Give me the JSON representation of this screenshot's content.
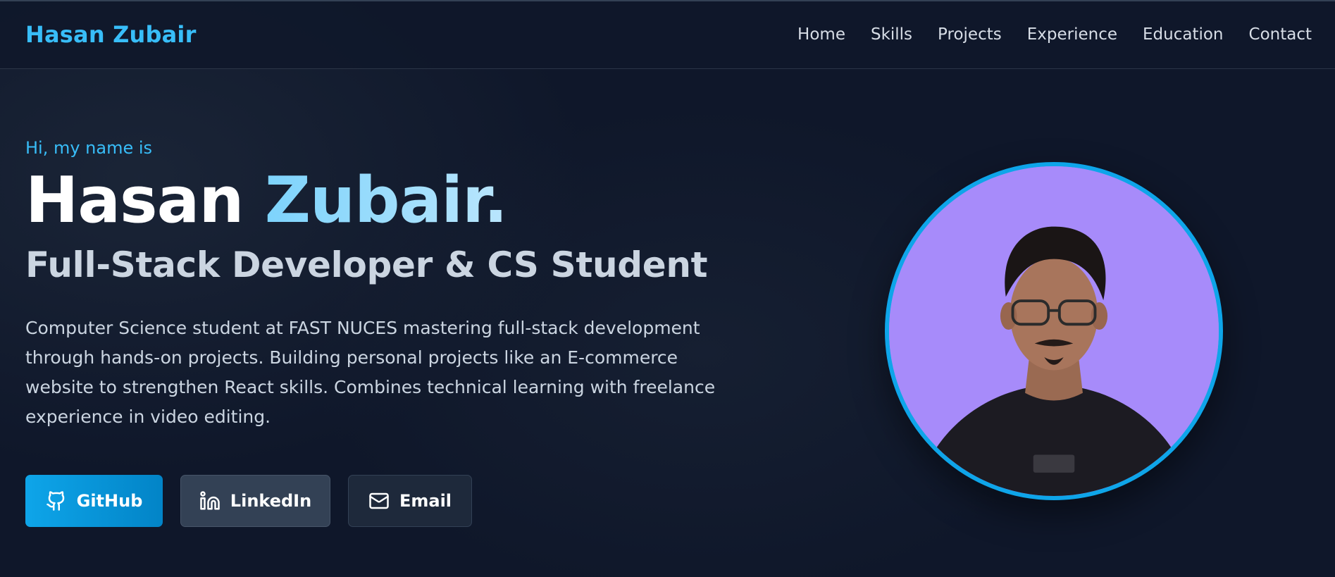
{
  "brand": {
    "name": "Hasan Zubair"
  },
  "nav": {
    "items": [
      "Home",
      "Skills",
      "Projects",
      "Experience",
      "Education",
      "Contact"
    ]
  },
  "hero": {
    "intro": "Hi, my name is",
    "first_name": "Hasan",
    "last_name": "Zubair.",
    "title": "Full-Stack Developer & CS Student",
    "bio": "Computer Science student at FAST NUCES mastering full-stack development through hands-on projects. Building personal projects like an E-commerce website to strengthen React skills. Combines technical learning with freelance experience in video editing."
  },
  "buttons": {
    "github": {
      "label": "GitHub",
      "icon": "github-icon"
    },
    "linkedin": {
      "label": "LinkedIn",
      "icon": "linkedin-icon"
    },
    "email": {
      "label": "Email",
      "icon": "mail-icon"
    }
  },
  "avatar": {
    "icon": "profile-photo"
  },
  "colors": {
    "background": "#0f172a",
    "accent": "#38bdf8",
    "avatar_ring": "#0ea5e9",
    "avatar_bg": "#a78bfa"
  }
}
